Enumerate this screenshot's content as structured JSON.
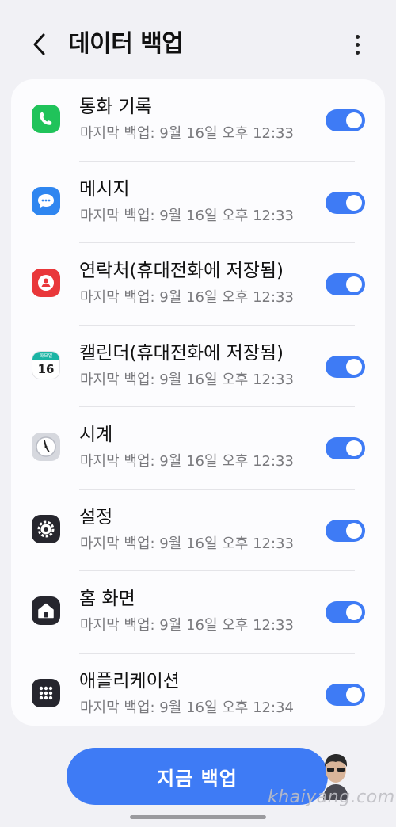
{
  "header": {
    "title": "데이터 백업"
  },
  "items": [
    {
      "title": "통화 기록",
      "subtitle": "마지막 백업: 9월 16일 오후 12:33",
      "icon": "phone-icon",
      "enabled": true
    },
    {
      "title": "메시지",
      "subtitle": "마지막 백업: 9월 16일 오후 12:33",
      "icon": "messages-icon",
      "enabled": true
    },
    {
      "title": "연락처(휴대전화에 저장됨)",
      "subtitle": "마지막 백업: 9월 16일 오후 12:33",
      "icon": "contacts-icon",
      "enabled": true
    },
    {
      "title": "캘린더(휴대전화에 저장됨)",
      "subtitle": "마지막 백업: 9월 16일 오후 12:33",
      "icon": "calendar-icon",
      "icon_text": "16",
      "icon_header": "화요일",
      "enabled": true
    },
    {
      "title": "시계",
      "subtitle": "마지막 백업: 9월 16일 오후 12:33",
      "icon": "clock-icon",
      "enabled": true
    },
    {
      "title": "설정",
      "subtitle": "마지막 백업: 9월 16일 오후 12:33",
      "icon": "settings-icon",
      "enabled": true
    },
    {
      "title": "홈 화면",
      "subtitle": "마지막 백업: 9월 16일 오후 12:33",
      "icon": "home-icon",
      "enabled": true
    },
    {
      "title": "애플리케이션",
      "subtitle": "마지막 백업: 9월 16일 오후 12:34",
      "icon": "apps-icon",
      "enabled": true
    }
  ],
  "backup_button": {
    "label": "지금 백업"
  },
  "watermark": "khaiyang.com",
  "colors": {
    "accent": "#3e7bf5",
    "background": "#f1f1f5",
    "card": "#fcfcfe"
  }
}
